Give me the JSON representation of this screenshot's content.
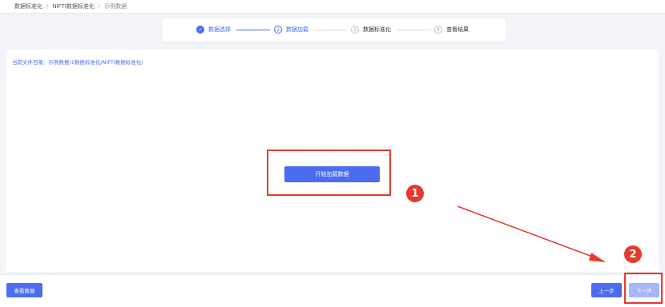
{
  "breadcrumb": {
    "items": [
      "数据标准化",
      "NIFTI数据标准化",
      "示例数据"
    ],
    "separator": "/"
  },
  "steps": [
    {
      "number": "✓",
      "label": "数据选择",
      "state": "done"
    },
    {
      "number": "2",
      "label": "数据加载",
      "state": "active"
    },
    {
      "number": "3",
      "label": "数据标准化",
      "state": "pending"
    },
    {
      "number": "4",
      "label": "查看结果",
      "state": "pending"
    }
  ],
  "main": {
    "directory_label": "当前文件目录：示例数据/1数据标准化/NIFTI数据标准化/",
    "load_button": "开始加载数据"
  },
  "annotations": {
    "marker_1": "1",
    "marker_2": "2"
  },
  "footer": {
    "view_data": "查看数据",
    "prev": "上一步",
    "next": "下一步"
  },
  "colors": {
    "accent": "#4b6cf0",
    "accent_disabled": "#a6b6f6",
    "annotation_red": "#e53a2d"
  }
}
